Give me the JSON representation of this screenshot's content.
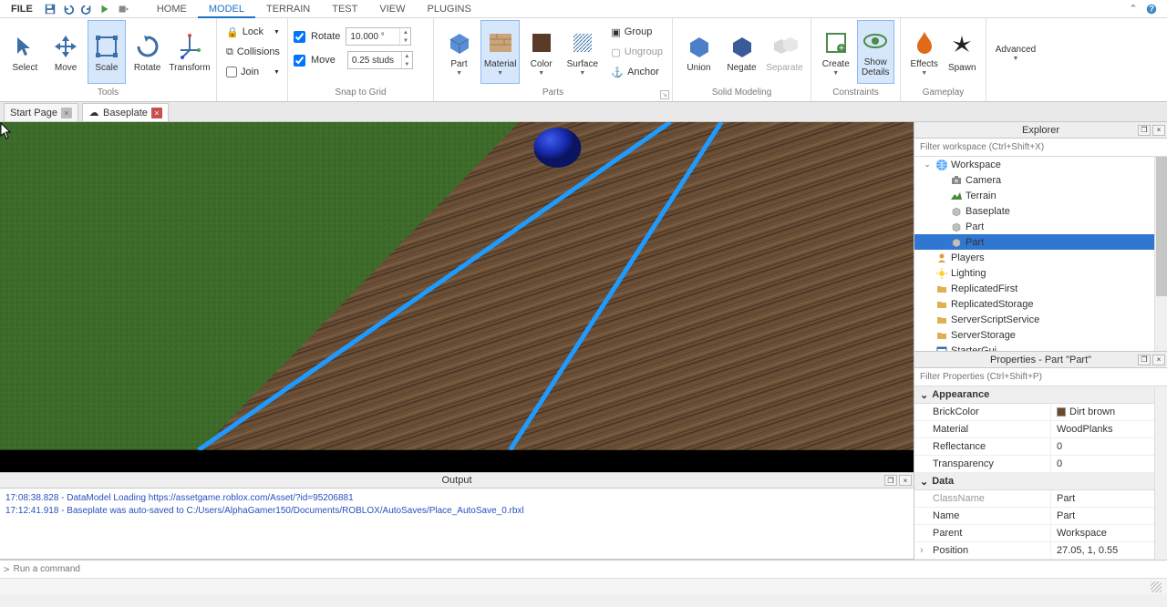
{
  "menubar": {
    "file_label": "FILE",
    "tabs": [
      "HOME",
      "MODEL",
      "TERRAIN",
      "TEST",
      "VIEW",
      "PLUGINS"
    ],
    "active_tab_index": 1
  },
  "ribbon": {
    "tools": {
      "label": "Tools",
      "buttons": [
        "Select",
        "Move",
        "Scale",
        "Rotate",
        "Transform"
      ],
      "active_index": 2
    },
    "clipboard": {
      "lock_label": "Lock",
      "collisions_label": "Collisions",
      "join_label": "Join"
    },
    "snap": {
      "label": "Snap to Grid",
      "rotate_label": "Rotate",
      "rotate_value": "10.000 °",
      "move_label": "Move",
      "move_value": "0.25 studs",
      "rotate_checked": true,
      "move_checked": true
    },
    "parts": {
      "label": "Parts",
      "buttons": [
        "Part",
        "Material",
        "Color",
        "Surface"
      ],
      "active_index": 1,
      "group_label": "Group",
      "ungroup_label": "Ungroup",
      "anchor_label": "Anchor"
    },
    "solid": {
      "label": "Solid Modeling",
      "buttons": [
        "Union",
        "Negate",
        "Separate"
      ],
      "disabled_index": 2
    },
    "constraints": {
      "label": "Constraints",
      "buttons": [
        "Create",
        "Show Details"
      ],
      "active_index": 1
    },
    "gameplay": {
      "label": "Gameplay",
      "buttons": [
        "Effects",
        "Spawn"
      ]
    },
    "advanced_label": "Advanced"
  },
  "doctabs": {
    "items": [
      {
        "label": "Start Page"
      },
      {
        "label": "Baseplate"
      }
    ],
    "active_index": 1
  },
  "explorer": {
    "title": "Explorer",
    "filter_placeholder": "Filter workspace (Ctrl+Shift+X)",
    "tree": [
      {
        "depth": 0,
        "twist": "v",
        "icon": "globe",
        "label": "Workspace"
      },
      {
        "depth": 1,
        "twist": "",
        "icon": "camera",
        "label": "Camera"
      },
      {
        "depth": 1,
        "twist": "",
        "icon": "terrain",
        "label": "Terrain"
      },
      {
        "depth": 1,
        "twist": "",
        "icon": "part",
        "label": "Baseplate"
      },
      {
        "depth": 1,
        "twist": "",
        "icon": "part",
        "label": "Part"
      },
      {
        "depth": 1,
        "twist": "",
        "icon": "part",
        "label": "Part",
        "selected": true
      },
      {
        "depth": 0,
        "twist": "",
        "icon": "players",
        "label": "Players"
      },
      {
        "depth": 0,
        "twist": "",
        "icon": "lighting",
        "label": "Lighting"
      },
      {
        "depth": 0,
        "twist": "",
        "icon": "folder",
        "label": "ReplicatedFirst"
      },
      {
        "depth": 0,
        "twist": "",
        "icon": "folder",
        "label": "ReplicatedStorage"
      },
      {
        "depth": 0,
        "twist": "",
        "icon": "folder",
        "label": "ServerScriptService"
      },
      {
        "depth": 0,
        "twist": "",
        "icon": "folder",
        "label": "ServerStorage"
      },
      {
        "depth": 0,
        "twist": "",
        "icon": "gui",
        "label": "StarterGui"
      }
    ]
  },
  "properties": {
    "title": "Properties - Part \"Part\"",
    "filter_placeholder": "Filter Properties (Ctrl+Shift+P)",
    "groups": [
      {
        "name": "Appearance",
        "rows": [
          {
            "k": "BrickColor",
            "v": "Dirt brown",
            "swatch": "#6b4a2c"
          },
          {
            "k": "Material",
            "v": "WoodPlanks"
          },
          {
            "k": "Reflectance",
            "v": "0"
          },
          {
            "k": "Transparency",
            "v": "0"
          }
        ]
      },
      {
        "name": "Data",
        "rows": [
          {
            "k": "ClassName",
            "v": "Part",
            "readonly": true
          },
          {
            "k": "Name",
            "v": "Part"
          },
          {
            "k": "Parent",
            "v": "Workspace"
          },
          {
            "k": "Position",
            "v": "27.05, 1, 0.55",
            "twist": ">"
          }
        ]
      }
    ]
  },
  "output": {
    "title": "Output",
    "lines": [
      "17:08:38.828 - DataModel Loading https://assetgame.roblox.com/Asset/?id=95206881",
      "17:12:41.918 - Baseplate was auto-saved to C:/Users/AlphaGamer150/Documents/ROBLOX/AutoSaves/Place_AutoSave_0.rbxl"
    ]
  },
  "cmdbar": {
    "placeholder": "Run a command"
  }
}
